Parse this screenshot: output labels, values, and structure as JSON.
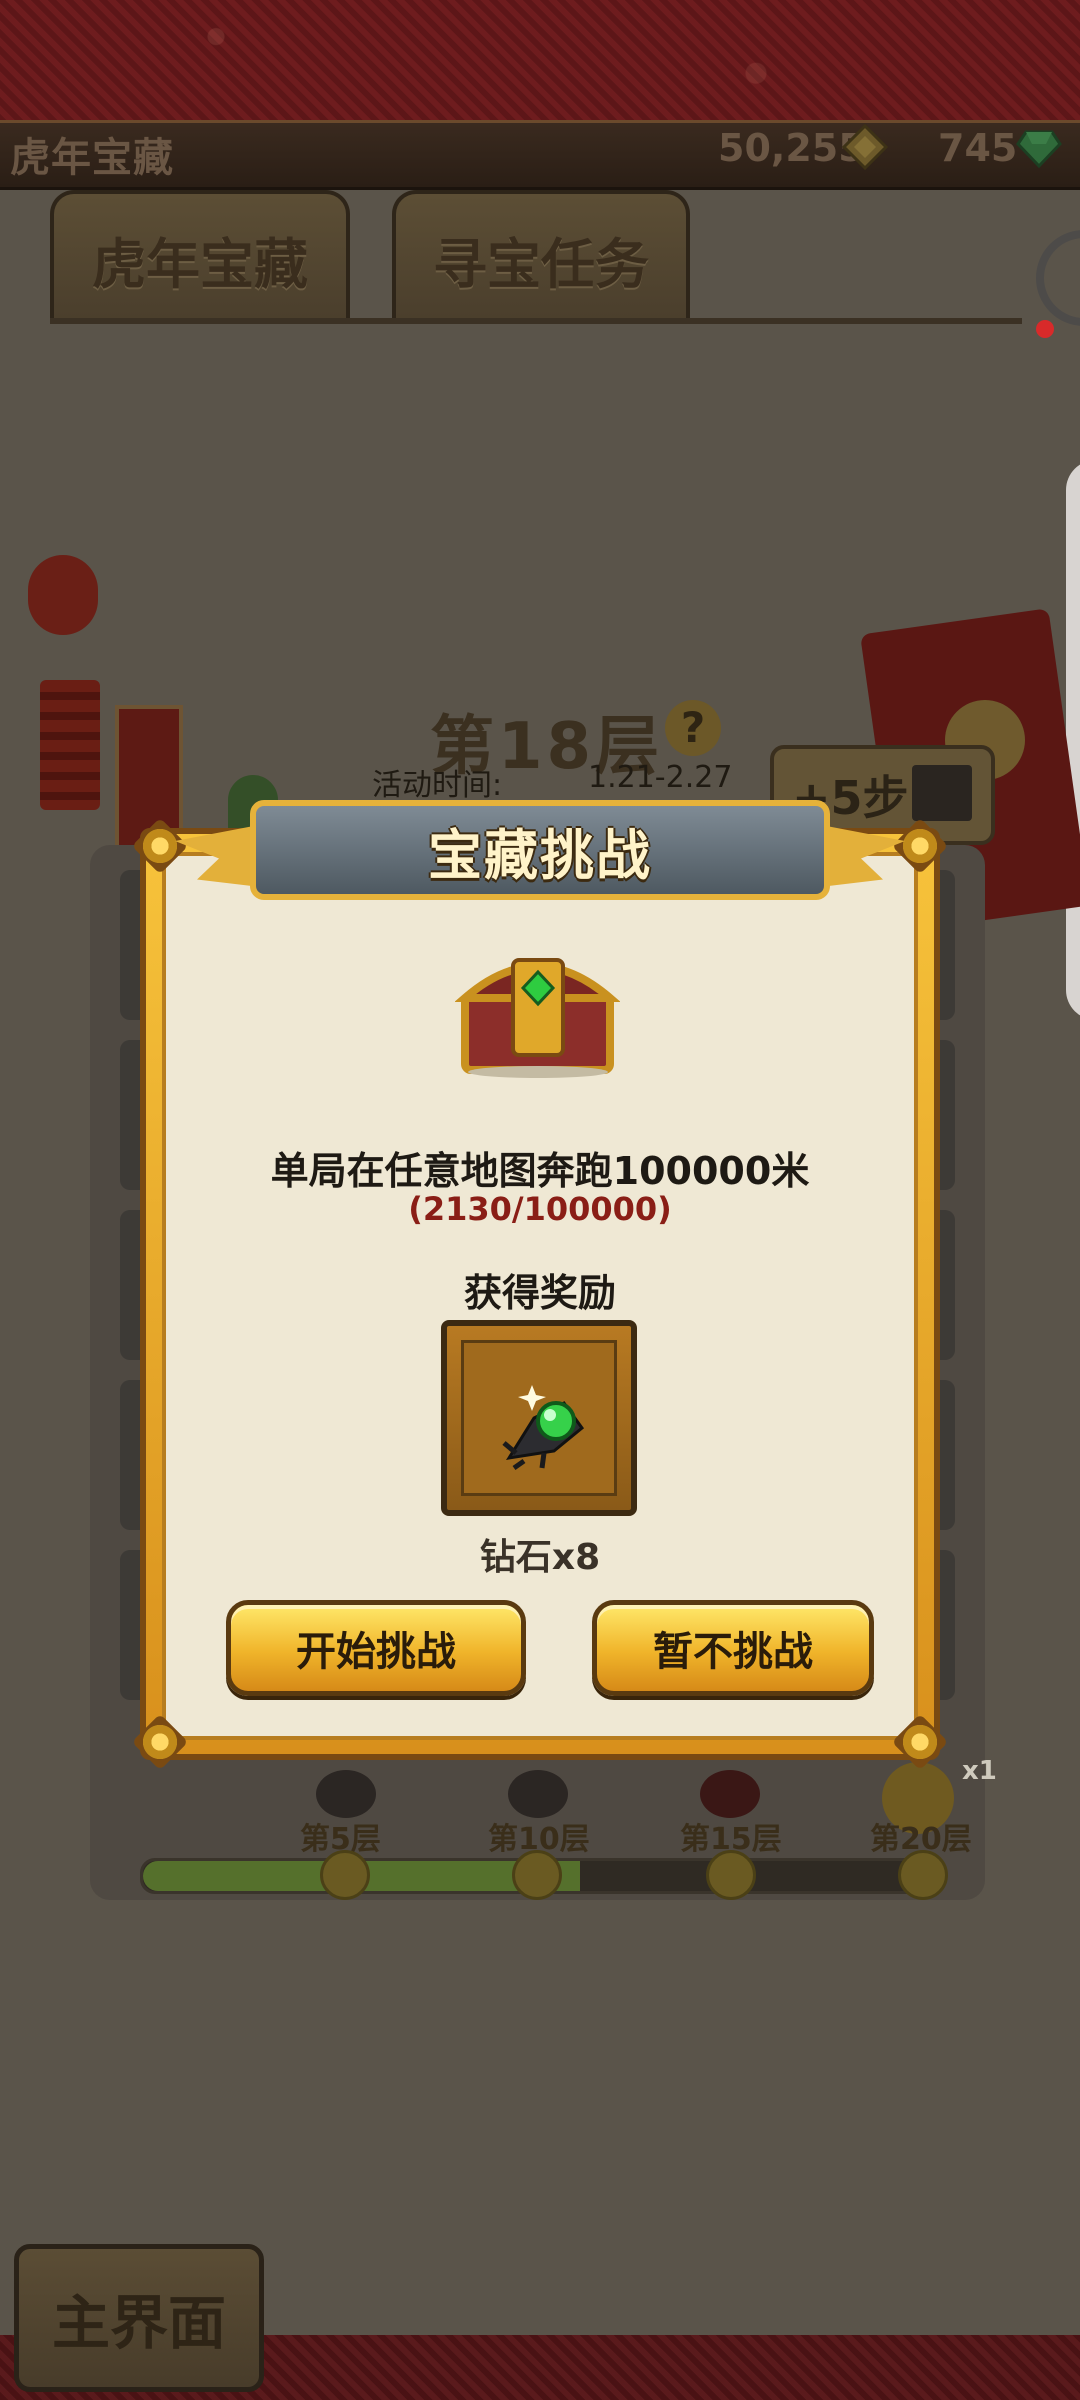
{
  "header": {
    "title": "虎年宝藏",
    "coins": "50,255",
    "gems": "745"
  },
  "tabs": [
    {
      "label": "虎年宝藏"
    },
    {
      "label": "寻宝任务"
    }
  ],
  "floor": {
    "title": "第18层",
    "time_label": "活动时间:",
    "time_value": "1.21-2.27",
    "steps_button": "+5步"
  },
  "modal": {
    "title": "宝藏挑战",
    "challenge": "单局在任意地图奔跑100000米",
    "progress": "(2130/100000)",
    "reward_label": "获得奖励",
    "reward_name": "钻石x8",
    "start_button": "开始挑战",
    "decline_button": "暂不挑战"
  },
  "milestones": [
    "第5层",
    "第10层",
    "第15层",
    "第20层"
  ],
  "milestone_reward_count": "x1",
  "progress_fraction": 0.56,
  "home_button": "主界面",
  "colors": {
    "gold": "#f0b42a",
    "progress_text": "#8a1e16",
    "gem_green": "#2ecc40"
  }
}
